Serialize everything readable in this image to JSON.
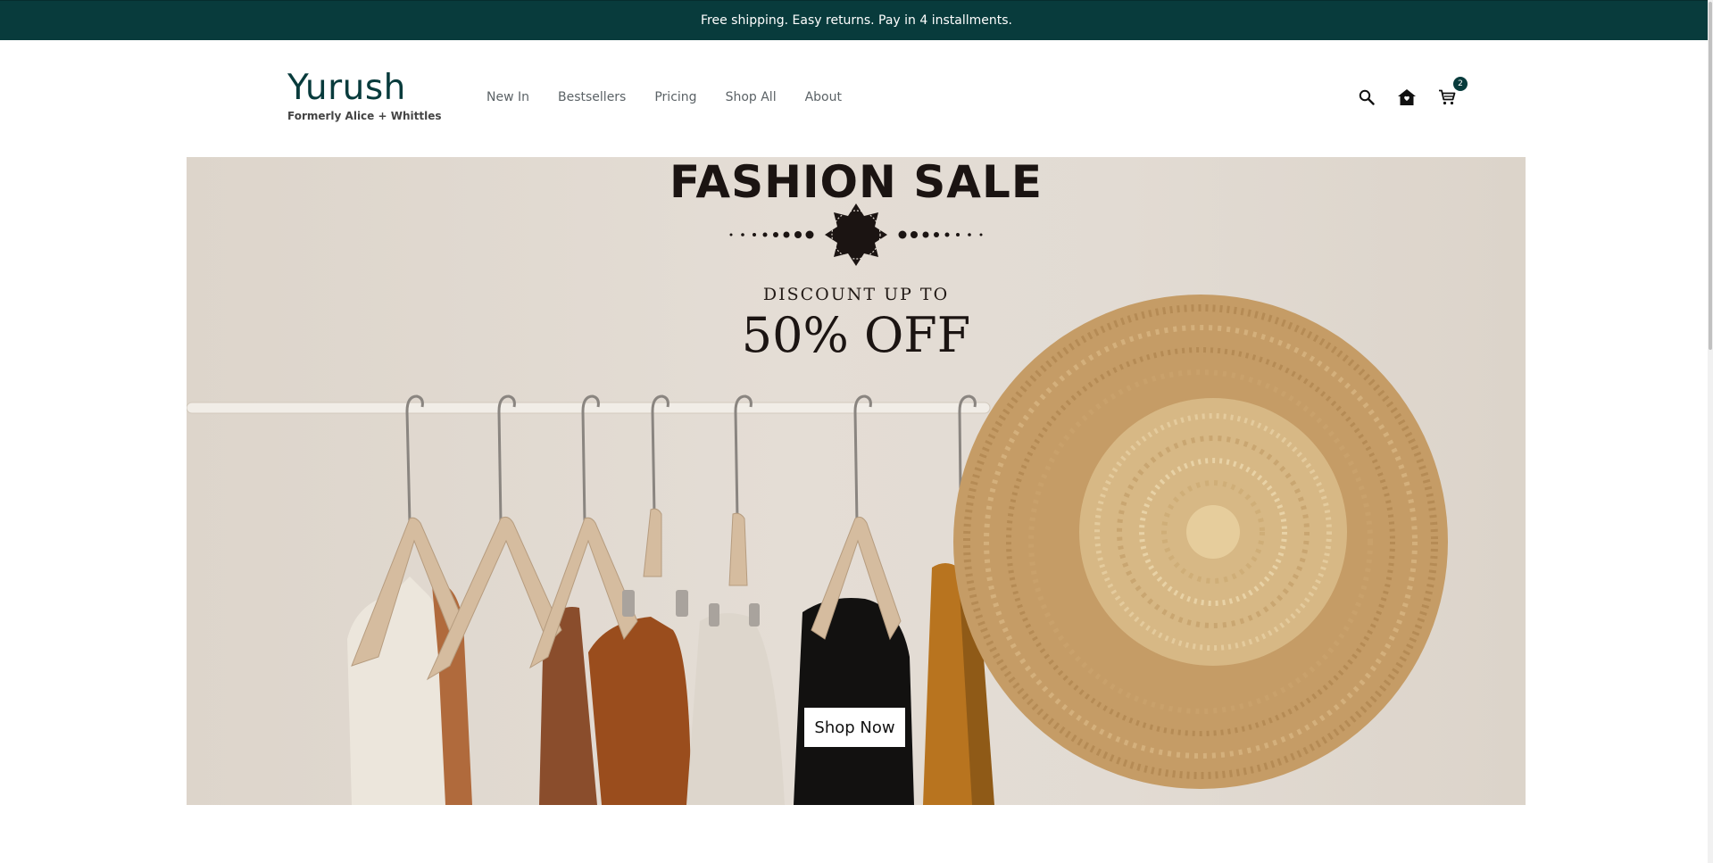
{
  "announcement": "Free shipping. Easy returns. Pay in 4 installments.",
  "brand": {
    "name": "Yurush",
    "tagline": "Formerly Alice + Whittles"
  },
  "nav": [
    {
      "label": "New In"
    },
    {
      "label": "Bestsellers"
    },
    {
      "label": "Pricing"
    },
    {
      "label": "Shop All"
    },
    {
      "label": "About"
    }
  ],
  "header_icons": [
    "search-icon",
    "home-icon",
    "cart-icon"
  ],
  "cart": {
    "count": "2"
  },
  "hero": {
    "headline": "FASHION SALE",
    "subheadline": "DISCOUNT UP TO",
    "offer": "50% OFF",
    "cta": "Shop Now"
  },
  "colors": {
    "brand": "#083b3c",
    "announcement_bg": "#083b3c",
    "hero_bg": "#e2dbd3",
    "hero_text": "#1b1412"
  }
}
